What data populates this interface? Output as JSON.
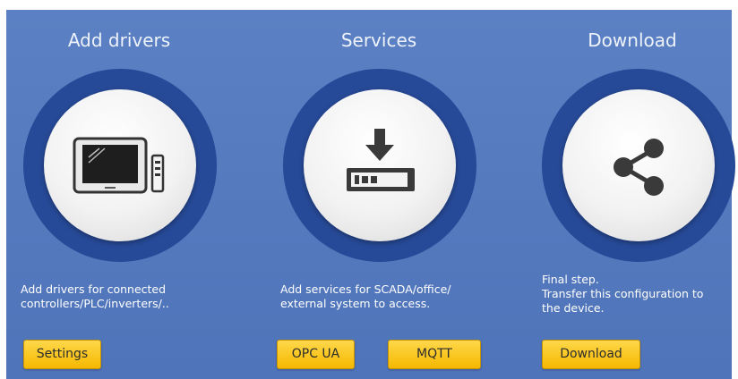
{
  "columns": [
    {
      "title": "Add drivers",
      "icon": "devices-icon",
      "description": [
        "Add drivers for connected",
        "controllers/PLC/inverters/.."
      ],
      "buttons": [
        "Settings"
      ]
    },
    {
      "title": "Services",
      "icon": "install-download-icon",
      "description": [
        "Add services for SCADA/office/",
        "external system to access."
      ],
      "buttons": [
        "OPC UA",
        "MQTT"
      ]
    },
    {
      "title": "Download",
      "icon": "share-icon",
      "description": [
        "Final step.",
        "Transfer this configuration to",
        "the device."
      ],
      "buttons": [
        "Download"
      ]
    }
  ],
  "colors": {
    "panel": "#5b80c3",
    "ring": "#274a98",
    "button": "#f5b800"
  }
}
